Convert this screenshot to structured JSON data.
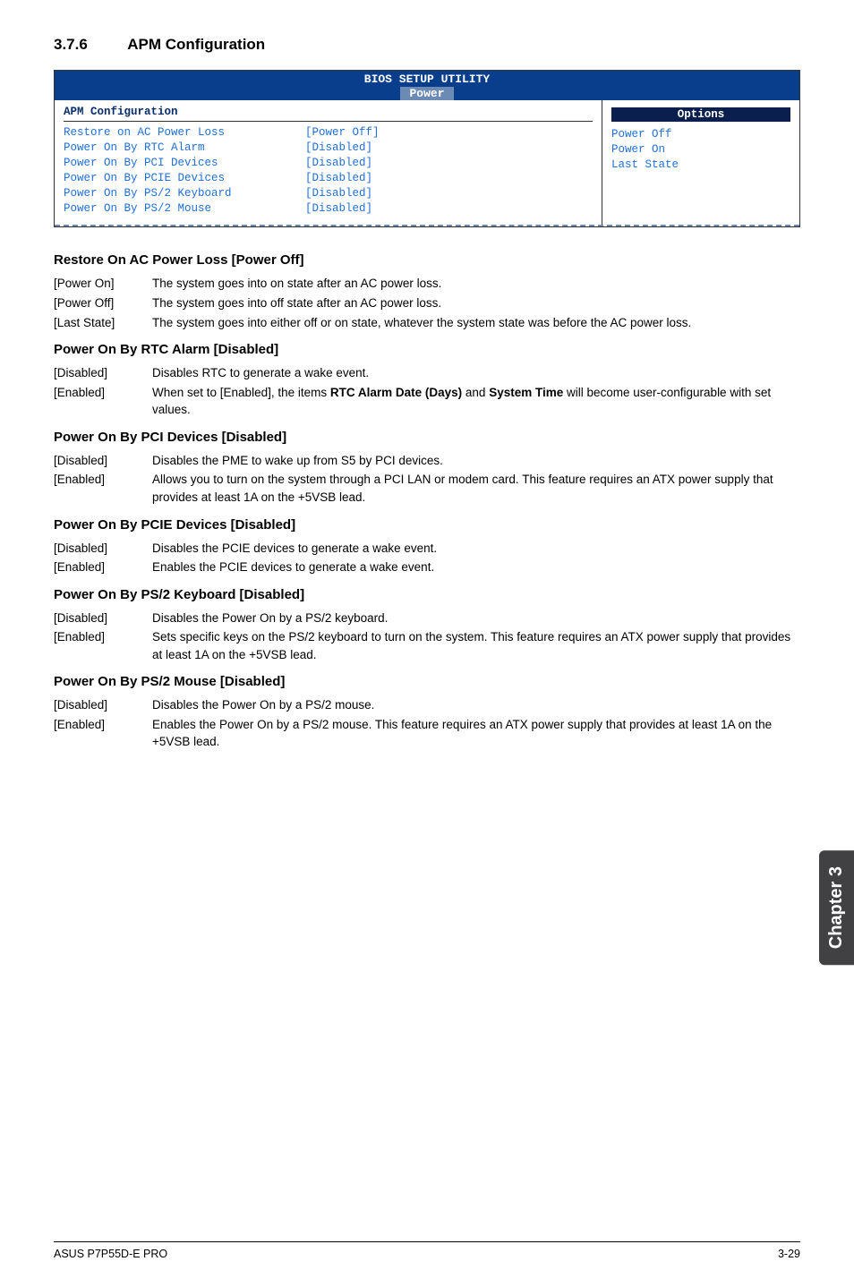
{
  "section": {
    "number": "3.7.6",
    "title": "APM Configuration"
  },
  "bios": {
    "header_top": "BIOS SETUP UTILITY",
    "header_tab": "Power",
    "apm_title": "APM Configuration",
    "rows": [
      {
        "label": "Restore on AC Power Loss",
        "value": "[Power Off]"
      },
      {
        "label": "Power On By RTC Alarm",
        "value": "[Disabled]"
      },
      {
        "label": "Power On By PCI Devices",
        "value": "[Disabled]"
      },
      {
        "label": "Power On By PCIE Devices",
        "value": "[Disabled]"
      },
      {
        "label": "Power On By PS/2 Keyboard",
        "value": "[Disabled]"
      },
      {
        "label": "Power On By PS/2 Mouse",
        "value": "[Disabled]"
      }
    ],
    "options_title": "Options",
    "options": [
      "Power Off",
      "Power On",
      "Last State"
    ]
  },
  "settings": [
    {
      "title": "Restore On AC Power Loss [Power Off]",
      "opts": [
        {
          "k": "[Power On]",
          "v": "The system goes into on state after an AC power loss."
        },
        {
          "k": "[Power Off]",
          "v": "The system goes into off state after an AC power loss."
        },
        {
          "k": "[Last State]",
          "v": "The system goes into either off or on state, whatever the system state was before the AC power loss."
        }
      ]
    },
    {
      "title": "Power On By RTC Alarm [Disabled]",
      "opts": [
        {
          "k": "[Disabled]",
          "v": "Disables RTC to generate a wake event."
        },
        {
          "k": "[Enabled]",
          "v": "When set to [Enabled], the items <b>RTC Alarm Date (Days)</b> and <b>System Time</b> will become user-configurable with set values."
        }
      ]
    },
    {
      "title": "Power On By PCI Devices [Disabled]",
      "opts": [
        {
          "k": "[Disabled]",
          "v": "Disables the PME to wake up from S5 by PCI devices."
        },
        {
          "k": "[Enabled]",
          "v": "Allows you to turn on the system through a PCI LAN or modem card. This feature requires an ATX power supply that provides at least 1A on the +5VSB lead."
        }
      ]
    },
    {
      "title": "Power On By PCIE Devices [Disabled]",
      "opts": [
        {
          "k": "[Disabled]",
          "v": "Disables the PCIE devices to generate a wake event."
        },
        {
          "k": "[Enabled]",
          "v": "Enables the PCIE devices to generate a wake event."
        }
      ]
    },
    {
      "title": "Power On By PS/2 Keyboard [Disabled]",
      "opts": [
        {
          "k": "[Disabled]",
          "v": "Disables the Power On by a PS/2 keyboard."
        },
        {
          "k": "[Enabled]",
          "v": "Sets specific keys on the PS/2 keyboard to turn on the system. This feature requires an ATX power supply that provides at least 1A on the +5VSB lead."
        }
      ]
    },
    {
      "title": "Power On By PS/2 Mouse [Disabled]",
      "opts": [
        {
          "k": "[Disabled]",
          "v": "Disables the Power On by a PS/2 mouse."
        },
        {
          "k": "[Enabled]",
          "v": "Enables the Power On by a PS/2 mouse. This feature requires an ATX power supply that provides at least 1A on the +5VSB lead."
        }
      ]
    }
  ],
  "side_tab": "Chapter 3",
  "footer": {
    "left": "ASUS P7P55D-E PRO",
    "right": "3-29"
  }
}
